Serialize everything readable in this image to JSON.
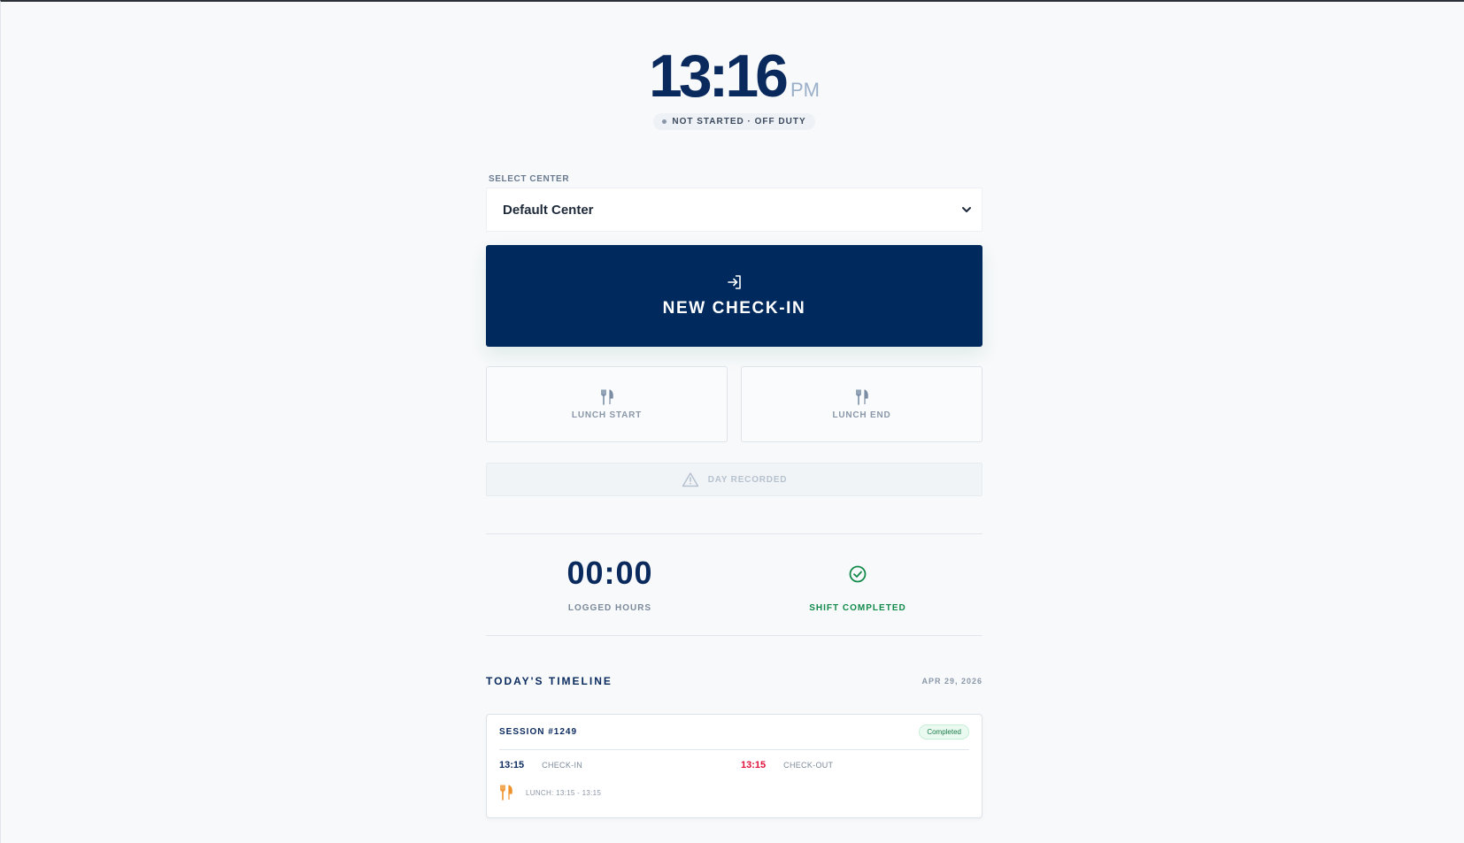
{
  "clock": {
    "time": "13:16",
    "ampm": "PM",
    "status": "NOT STARTED · OFF DUTY"
  },
  "center_select": {
    "label": "SELECT CENTER",
    "value": "Default Center"
  },
  "actions": {
    "checkin_label": "NEW CHECK-IN",
    "lunch_start_label": "LUNCH START",
    "lunch_end_label": "LUNCH END",
    "day_recorded_label": "DAY RECORDED"
  },
  "stats": {
    "logged_hours_value": "00:00",
    "logged_hours_label": "LOGGED HOURS",
    "shift_label": "SHIFT COMPLETED"
  },
  "timeline": {
    "title": "TODAY'S TIMELINE",
    "date": "APR 29, 2026",
    "sessions": [
      {
        "id": "SESSION #1249",
        "badge": "Completed",
        "checkin_time": "13:15",
        "checkin_label": "CHECK-IN",
        "checkout_time": "13:15",
        "checkout_label": "CHECK-OUT",
        "lunch": "LUNCH: 13:15 - 13:15"
      }
    ]
  },
  "icons": {
    "checkin": "login-icon",
    "lunch": "fork-knife-icon",
    "warning": "warning-triangle-icon",
    "check": "check-circle-icon",
    "select": "chevron-down-icon"
  },
  "colors": {
    "primary": "#002a5e",
    "success": "#128a4a",
    "danger": "#e0103a",
    "lunch_accent": "#f0922b"
  }
}
